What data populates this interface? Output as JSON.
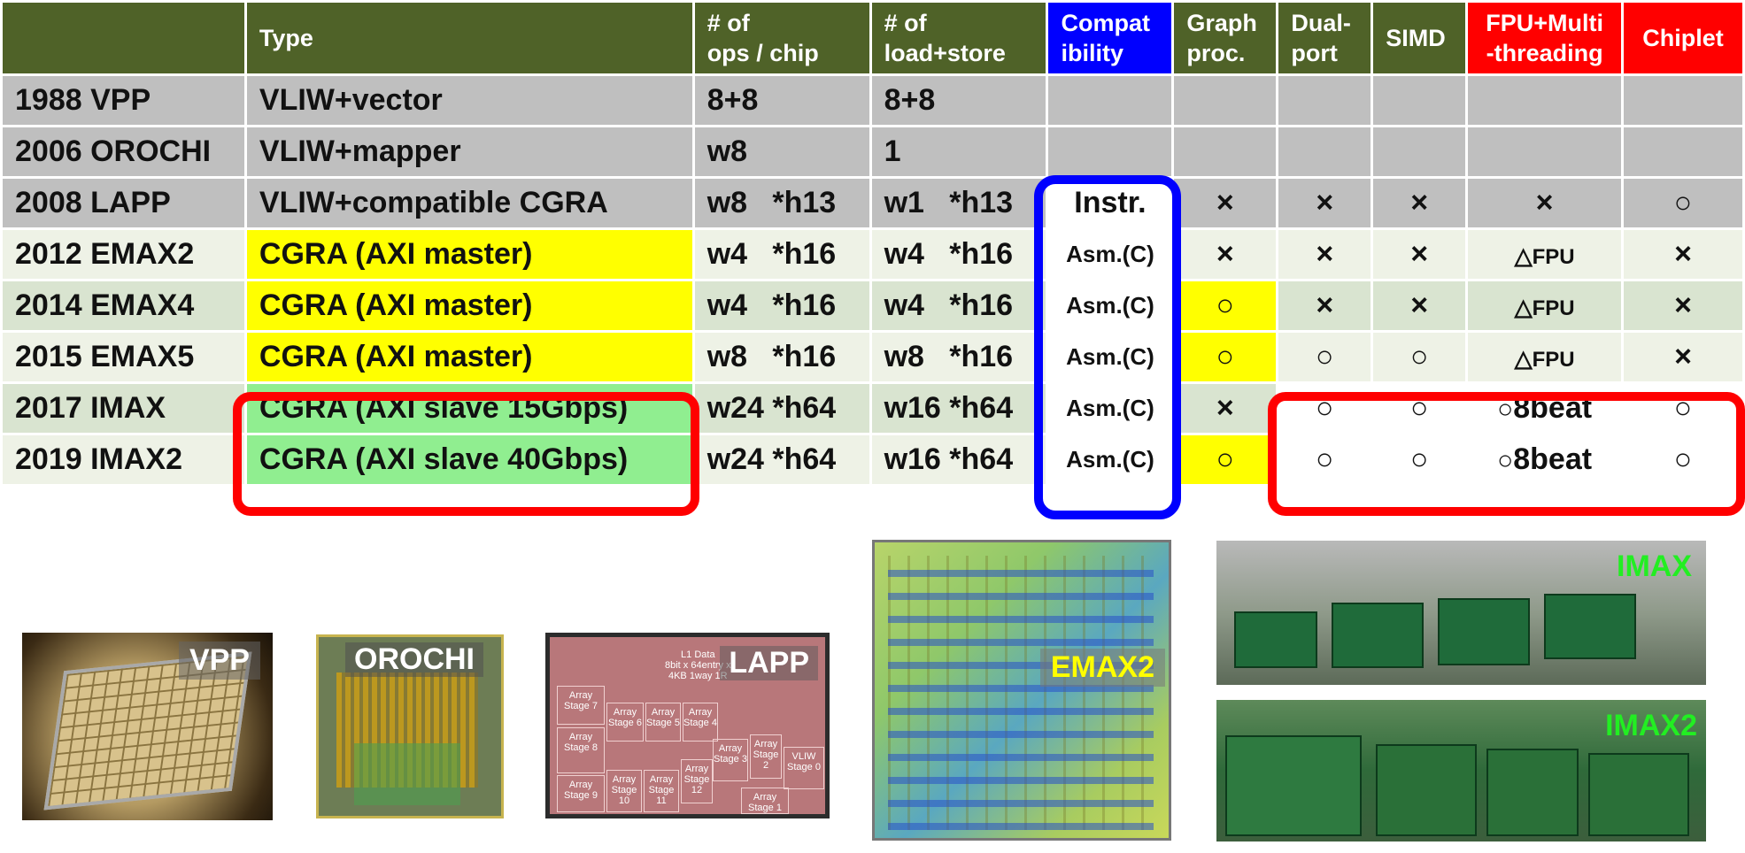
{
  "headers": {
    "blank": "",
    "type": "Type",
    "ops": [
      "# of",
      "ops / chip"
    ],
    "ls": [
      "# of",
      "load+store"
    ],
    "compat": [
      "Compat",
      "ibility"
    ],
    "graph": [
      "Graph",
      "proc."
    ],
    "dual": [
      "Dual-",
      "port"
    ],
    "simd": "SIMD",
    "fpu": [
      "FPU+Multi",
      "-threading"
    ],
    "chiplet": "Chiplet"
  },
  "rows": [
    {
      "name": "1988 VPP",
      "type": "VLIW+vector",
      "ops": "8+8",
      "ls": "8+8",
      "compat": "",
      "graph": "",
      "dual": "",
      "simd": "",
      "fpu": "",
      "chiplet": ""
    },
    {
      "name": "2006 OROCHI",
      "type": "VLIW+mapper",
      "ops": "w8",
      "ls": "1",
      "compat": "",
      "graph": "",
      "dual": "",
      "simd": "",
      "fpu": "",
      "chiplet": ""
    },
    {
      "name": "2008 LAPP",
      "type": "VLIW+compatible CGRA",
      "ops": "w8   *h13",
      "ls": "w1   *h13",
      "compat": "Instr.",
      "graph": "×",
      "dual": "×",
      "simd": "×",
      "fpu": "×",
      "chiplet": "○"
    },
    {
      "name": "2012 EMAX2",
      "type": "CGRA (AXI master)",
      "ops": "w4   *h16",
      "ls": "w4   *h16",
      "compat": "Asm.(C)",
      "graph": "×",
      "dual": "×",
      "simd": "×",
      "fpu_sym": "△",
      "fpu_txt": "FPU",
      "chiplet": "×"
    },
    {
      "name": "2014 EMAX4",
      "type": "CGRA (AXI master)",
      "ops": "w4   *h16",
      "ls": "w4   *h16",
      "compat": "Asm.(C)",
      "graph": "○",
      "dual": "×",
      "simd": "×",
      "fpu_sym": "△",
      "fpu_txt": "FPU",
      "chiplet": "×"
    },
    {
      "name": "2015 EMAX5",
      "type": "CGRA (AXI master)",
      "ops": "w8   *h16",
      "ls": "w8   *h16",
      "compat": "Asm.(C)",
      "graph": "○",
      "dual": "○",
      "simd": "○",
      "fpu_sym": "△",
      "fpu_txt": "FPU",
      "chiplet": "×"
    },
    {
      "name": "2017 IMAX",
      "type": "CGRA (AXI slave 15Gbps)",
      "ops": "w24 *h64",
      "ls": "w16 *h64",
      "compat": "Asm.(C)",
      "graph": "×",
      "dual": "○",
      "simd": "○",
      "fpu_sym": "○",
      "fpu_txt": "8beat",
      "chiplet": "○"
    },
    {
      "name": "2019 IMAX2",
      "type": "CGRA (AXI slave 40Gbps)",
      "ops": "w24 *h64",
      "ls": "w16 *h64",
      "compat": "Asm.(C)",
      "graph": "○",
      "dual": "○",
      "simd": "○",
      "fpu_sym": "○",
      "fpu_txt": "8beat",
      "chiplet": "○"
    }
  ],
  "photos": {
    "vpp": "VPP",
    "orochi": "OROCHI",
    "lapp": "LAPP",
    "lapp_note": [
      "L1 Data",
      "8bit x 64entry x",
      "4KB 1way 1R"
    ],
    "lapp_stages": [
      "Array Stage 7",
      "Array Stage 8",
      "Array Stage 6",
      "Array Stage 5",
      "Array Stage 4",
      "Array Stage 3",
      "Array Stage 2",
      "VLIW Stage 0",
      "Array Stage 9",
      "Array Stage 10",
      "Array Stage 11",
      "Array Stage 12",
      "Array Stage 1"
    ],
    "emax2": "EMAX2",
    "imax": "IMAX",
    "imax2": "IMAX2"
  },
  "colors": {
    "header_green": "#4f6228",
    "compat_blue": "#0000ff",
    "highlight_red": "#ff0000",
    "yellow": "#ffff00",
    "light_green": "#90ee90",
    "row_gray": "#bfbfbf"
  }
}
